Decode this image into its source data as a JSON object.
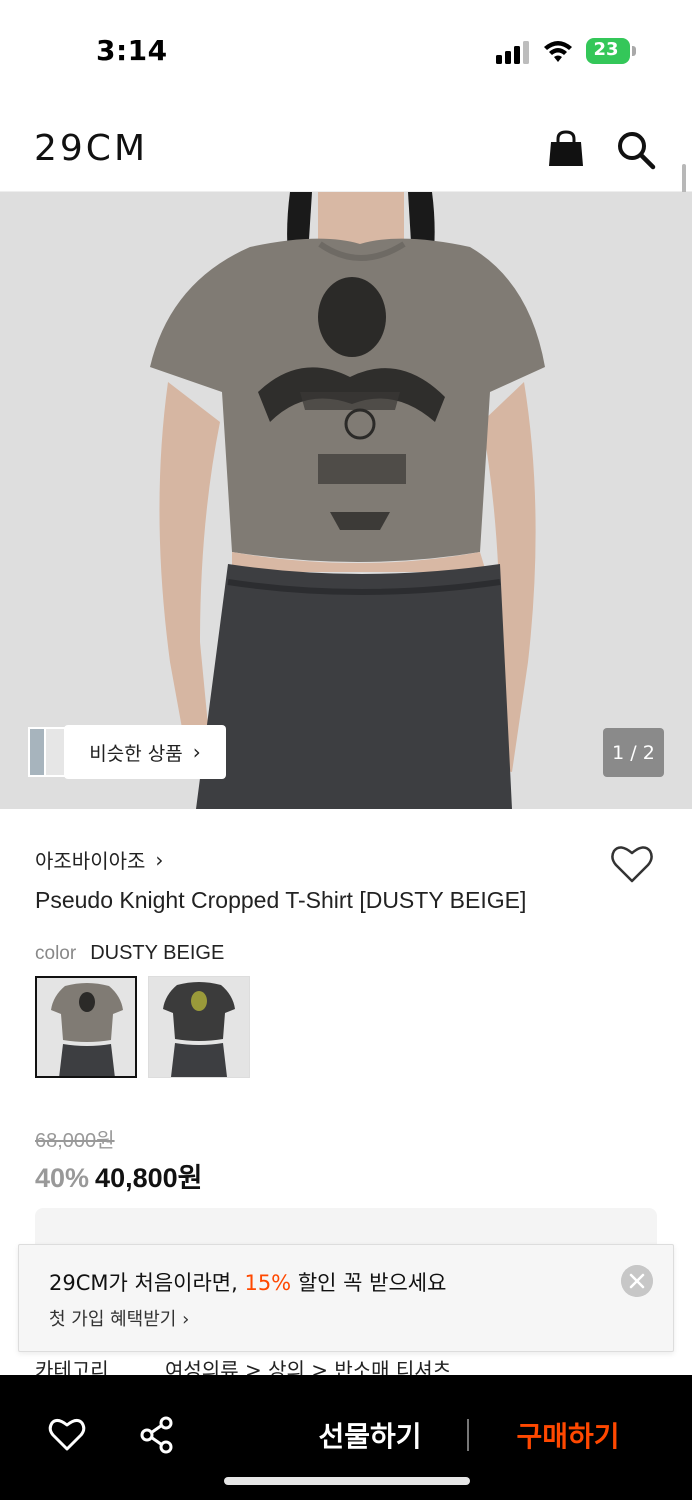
{
  "status_bar": {
    "time": "3:14",
    "battery": "23",
    "battery_color": "#34c759"
  },
  "header": {
    "logo": "29CM",
    "icons": [
      "shopping-bag-icon",
      "search-icon"
    ]
  },
  "gallery": {
    "similar_label": "비슷한 상품",
    "similar_chevron": "›",
    "page_counter": "1 / 2"
  },
  "product": {
    "brand": "아조바이아조",
    "brand_chevron": "›",
    "title": "Pseudo Knight Cropped T-Shirt [DUSTY BEIGE]",
    "color_label": "color",
    "color_value": "DUSTY BEIGE",
    "swatches": [
      "DUSTY BEIGE",
      "CHARCOAL"
    ],
    "original_price": "68,000원",
    "discount": "40%",
    "sale_price": "40,800원",
    "category_label": "카테고리",
    "category_path": "여성의류 > 상의 > 반소매 티셔츠"
  },
  "promo": {
    "line1_prefix": "29CM가 처음이라면, ",
    "line1_highlight": "15%",
    "line1_suffix": " 할인 꼭 받으세요",
    "line2": "첫 가입 혜택받기 ›",
    "accent_color": "#ff4800"
  },
  "bottom_bar": {
    "gift_label": "선물하기",
    "buy_label": "구매하기",
    "buy_color": "#ff4800"
  }
}
